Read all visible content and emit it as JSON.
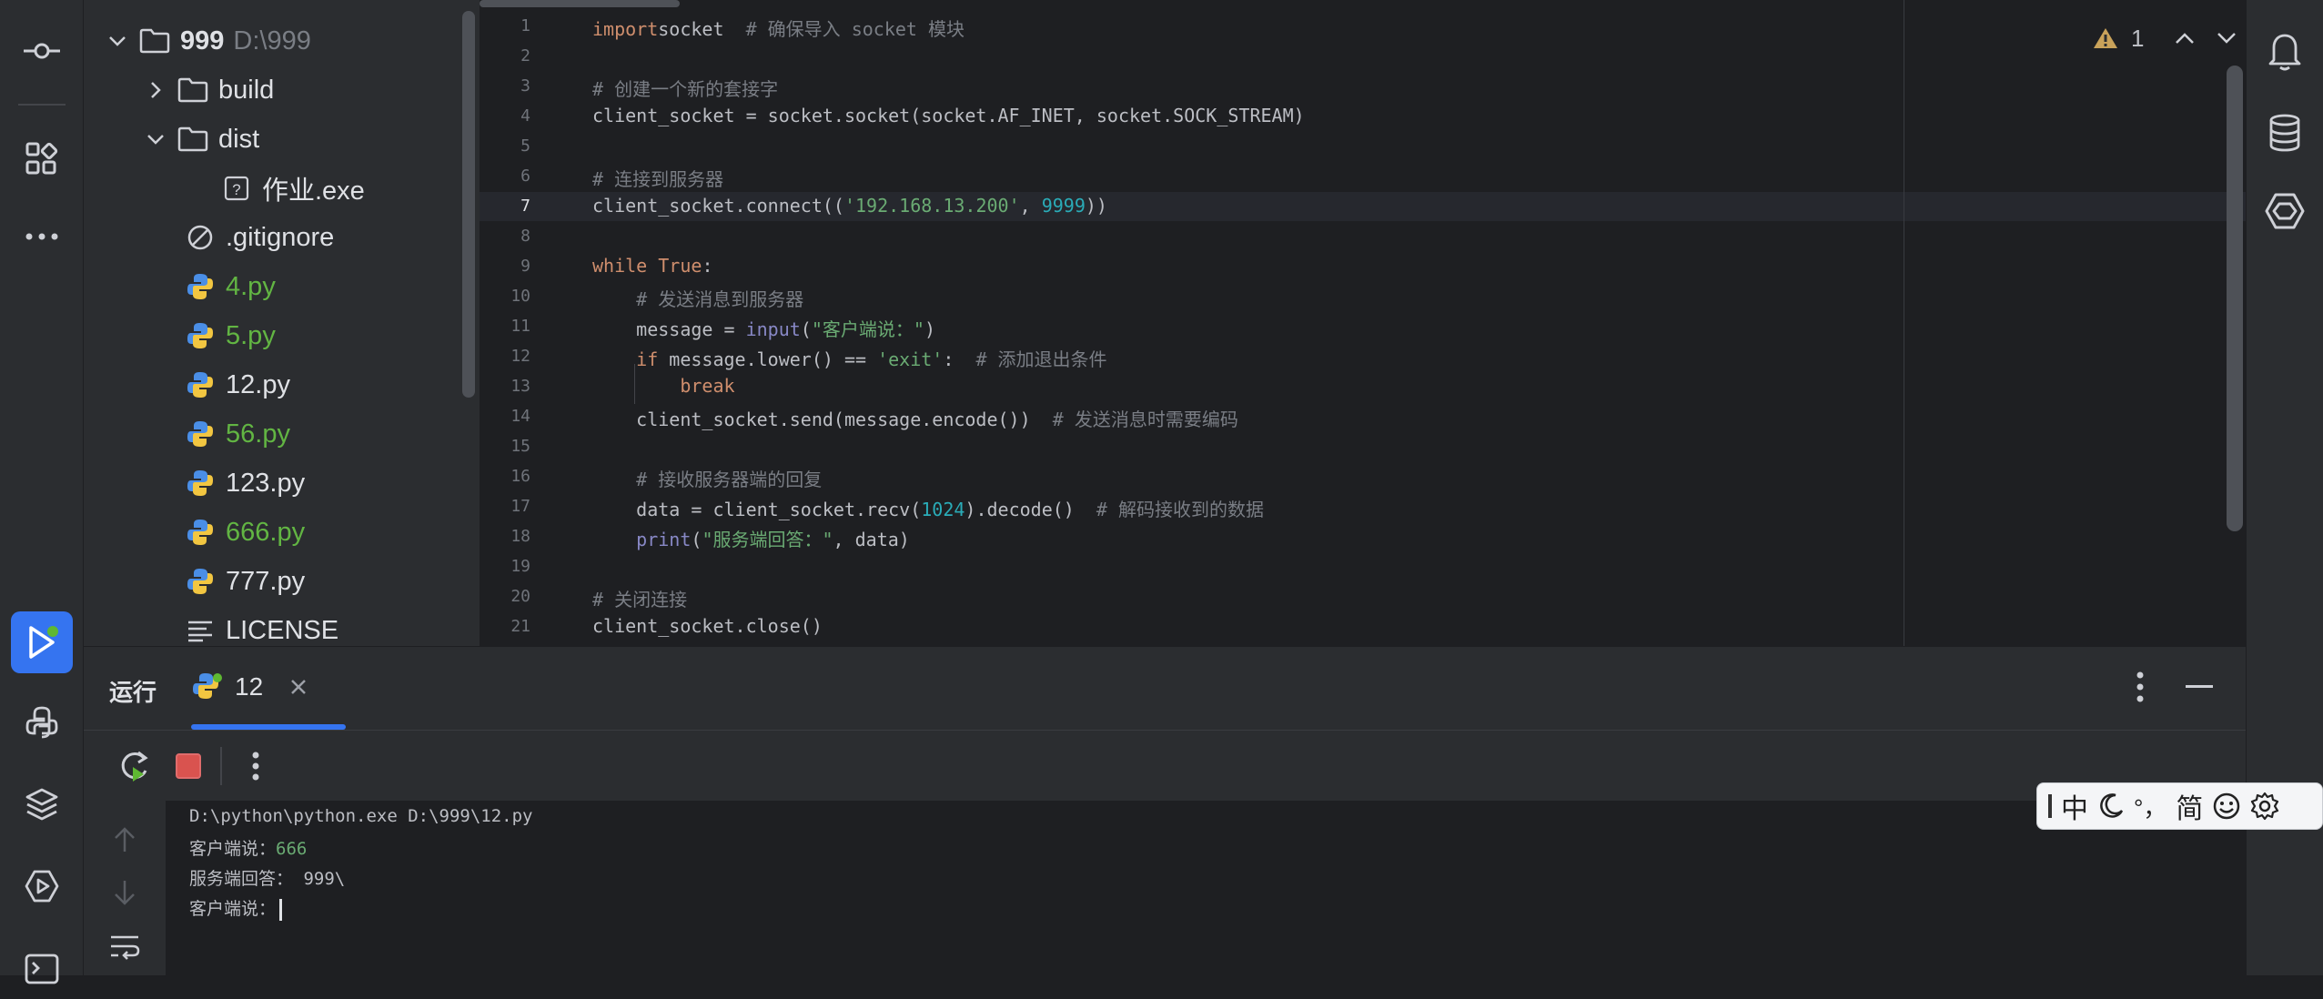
{
  "project_tree": [
    {
      "name": "999",
      "hint": "D:\\999",
      "type": "folder",
      "expanded": true,
      "bold": true,
      "color": "#dfe1e5"
    },
    {
      "name": "build",
      "type": "folder",
      "expanded": false,
      "color": "#dfe1e5"
    },
    {
      "name": "dist",
      "type": "folder",
      "expanded": true,
      "color": "#dfe1e5"
    },
    {
      "name": "作业.exe",
      "type": "unknown-file",
      "color": "#dfe1e5"
    },
    {
      "name": ".gitignore",
      "type": "ignore-file",
      "color": "#dfe1e5"
    },
    {
      "name": "4.py",
      "type": "python",
      "color": "#62b543"
    },
    {
      "name": "5.py",
      "type": "python",
      "color": "#62b543"
    },
    {
      "name": "12.py",
      "type": "python",
      "color": "#dfe1e5"
    },
    {
      "name": "56.py",
      "type": "python",
      "color": "#62b543"
    },
    {
      "name": "123.py",
      "type": "python",
      "color": "#dfe1e5"
    },
    {
      "name": "666.py",
      "type": "python",
      "color": "#62b543"
    },
    {
      "name": "777.py",
      "type": "python",
      "color": "#dfe1e5"
    },
    {
      "name": "LICENSE",
      "type": "text-file",
      "color": "#dfe1e5"
    }
  ],
  "editor": {
    "current_line": 7,
    "inspection_count": "1",
    "lines": [
      {
        "n": "1",
        "tokens": [
          [
            "kw",
            "import"
          ],
          [
            "",
            "socket  "
          ],
          [
            "cm",
            "# 确保导入 socket 模块"
          ]
        ]
      },
      {
        "n": "2",
        "tokens": []
      },
      {
        "n": "3",
        "tokens": [
          [
            "cm",
            "# 创建一个新的套接字"
          ]
        ]
      },
      {
        "n": "4",
        "tokens": [
          [
            "",
            "client_socket = socket.socket(socket.AF_INET, socket.SOCK_STREAM)"
          ]
        ]
      },
      {
        "n": "5",
        "tokens": []
      },
      {
        "n": "6",
        "tokens": [
          [
            "cm",
            "# 连接到服务器"
          ]
        ]
      },
      {
        "n": "7",
        "tokens": [
          [
            "",
            "client_socket.connect(("
          ],
          [
            "str",
            "'192.168.13.200'"
          ],
          [
            "",
            ", "
          ],
          [
            "num",
            "9999"
          ],
          [
            "",
            "))"
          ]
        ]
      },
      {
        "n": "8",
        "tokens": []
      },
      {
        "n": "9",
        "tokens": [
          [
            "kw",
            "while"
          ],
          [
            "",
            " "
          ],
          [
            "kw",
            "True"
          ],
          [
            "",
            ":"
          ]
        ]
      },
      {
        "n": "10",
        "tokens": [
          [
            "",
            "    "
          ],
          [
            "cm",
            "# 发送消息到服务器"
          ]
        ]
      },
      {
        "n": "11",
        "tokens": [
          [
            "",
            "    message = "
          ],
          [
            "fn",
            "input"
          ],
          [
            "",
            "("
          ],
          [
            "str",
            "\"客户端说：\""
          ],
          [
            "",
            ")"
          ]
        ]
      },
      {
        "n": "12",
        "tokens": [
          [
            "",
            "    "
          ],
          [
            "kw",
            "if"
          ],
          [
            "",
            " message.lower() == "
          ],
          [
            "str",
            "'exit'"
          ],
          [
            "",
            ":  "
          ],
          [
            "cm",
            "# 添加退出条件"
          ]
        ]
      },
      {
        "n": "13",
        "tokens": [
          [
            "",
            "        "
          ],
          [
            "kw",
            "break"
          ]
        ]
      },
      {
        "n": "14",
        "tokens": [
          [
            "",
            "    client_socket.send(message.encode())  "
          ],
          [
            "cm",
            "# 发送消息时需要编码"
          ]
        ]
      },
      {
        "n": "15",
        "tokens": []
      },
      {
        "n": "16",
        "tokens": [
          [
            "",
            "    "
          ],
          [
            "cm",
            "# 接收服务器端的回复"
          ]
        ]
      },
      {
        "n": "17",
        "tokens": [
          [
            "",
            "    data = client_socket.recv("
          ],
          [
            "num",
            "1024"
          ],
          [
            "",
            ").decode()  "
          ],
          [
            "cm",
            "# 解码接收到的数据"
          ]
        ]
      },
      {
        "n": "18",
        "tokens": [
          [
            "",
            "    "
          ],
          [
            "fn",
            "print"
          ],
          [
            "",
            "("
          ],
          [
            "str",
            "\"服务端回答：\""
          ],
          [
            "",
            ", data)"
          ]
        ]
      },
      {
        "n": "19",
        "tokens": []
      },
      {
        "n": "20",
        "tokens": [
          [
            "cm",
            "# 关闭连接"
          ]
        ]
      },
      {
        "n": "21",
        "tokens": [
          [
            "",
            "client_socket.close()"
          ]
        ]
      }
    ]
  },
  "run_window": {
    "title": "运行",
    "tab_label": "12",
    "console": {
      "command": "D:\\python\\python.exe D:\\999\\12.py",
      "line2_prompt": "客户端说：",
      "line2_input": "666",
      "line3": "服务端回答： 999\\",
      "line4_prompt": "客户端说："
    }
  },
  "ime_bar": {
    "mode": "中",
    "punct": "°，",
    "script": "简"
  },
  "icons": {
    "left_toolbar": [
      "commit-icon",
      "structure-icon",
      "more-icon",
      "run-icon",
      "python-console-icon",
      "layers-icon",
      "services-icon",
      "terminal-icon"
    ],
    "right_toolbar": [
      "notifications-icon",
      "database-icon",
      "ai-assistant-icon"
    ]
  }
}
